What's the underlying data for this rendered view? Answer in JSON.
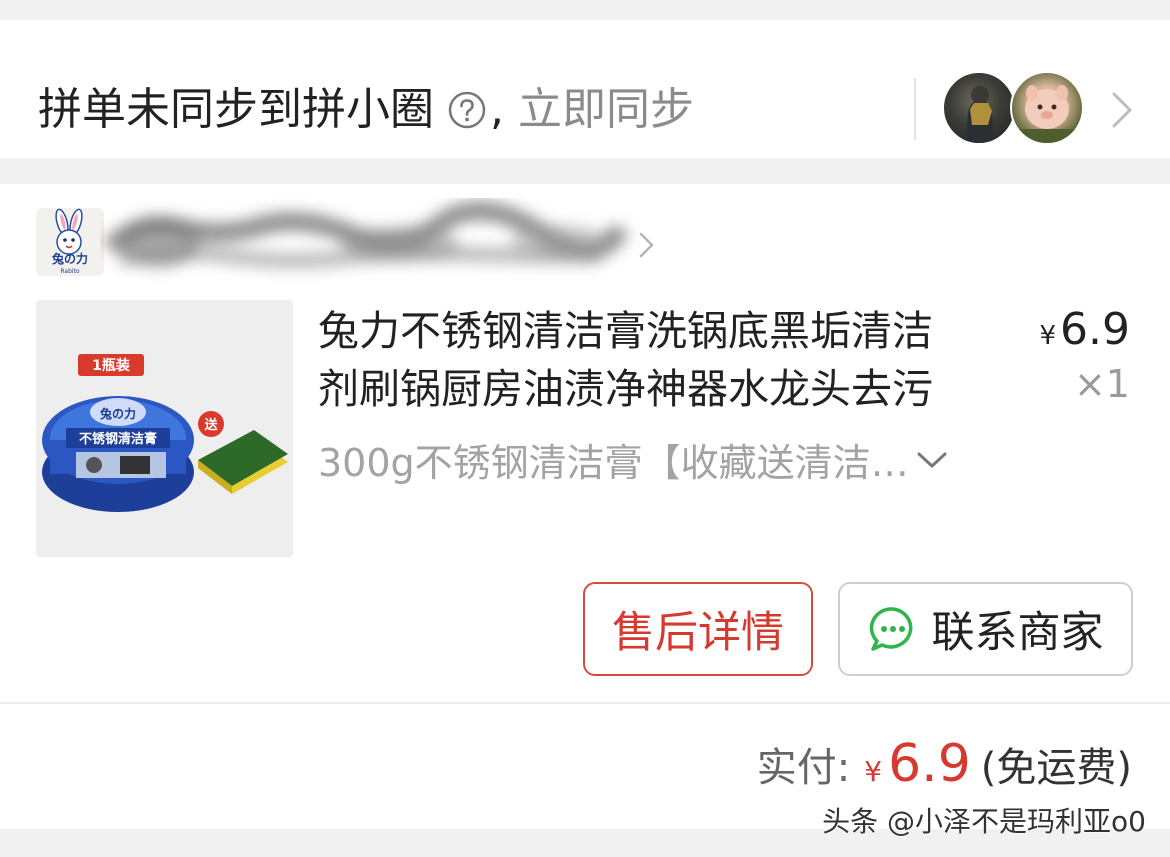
{
  "sync_bar": {
    "message": "拼单未同步到拼小圈",
    "comma": ",",
    "link": "立即同步",
    "help_icon": "question-circle-icon",
    "avatar_icon": "avatar-image",
    "chevron_icon": "chevron-right-icon"
  },
  "shop": {
    "logo_icon": "rabbit-logo-icon",
    "logo_text": "兔の力",
    "logo_subtext": "Rabito",
    "name_redacted": true,
    "chevron_icon": "chevron-right-icon"
  },
  "product": {
    "image_badge": "1瓶装",
    "image_gift": "送",
    "image_label": "不锈钢清洁膏",
    "image_brand": "兔の力",
    "title_line1": "兔力不锈钢清洁膏洗锅底黑垢清洁",
    "title_line2": "剂刷锅厨房油渍净神器水龙头去污",
    "currency_symbol": "¥",
    "price": "6.9",
    "quantity": "×1",
    "variant": "300g不锈钢清洁膏【收藏送清洁…",
    "variant_chevron": "chevron-down-icon"
  },
  "actions": {
    "after_sale": "售后详情",
    "contact_merchant": "联系商家",
    "contact_icon": "chat-bubble-icon",
    "accent_color": "#d6392f",
    "chat_color": "#2fb54a"
  },
  "payment": {
    "label": "实付:",
    "currency_symbol": "¥",
    "amount": "6.9",
    "note": "(免运费)"
  },
  "watermark": "头条 @小泽不是玛利亚o0"
}
